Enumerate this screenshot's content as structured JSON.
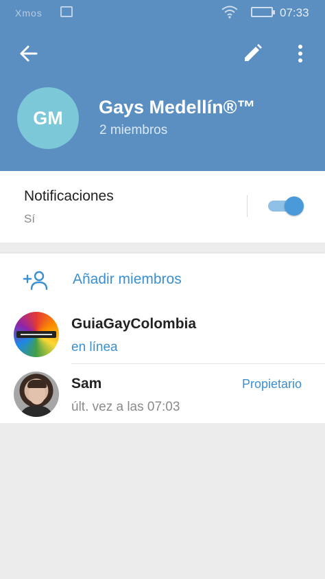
{
  "statusbar": {
    "carrier": "Xmos",
    "time": "07:33"
  },
  "header": {
    "avatar_initials": "GM",
    "title": "Gays Medellín®™",
    "subtitle": "2 miembros",
    "bg_color": "#5b8fc1"
  },
  "notifications": {
    "label": "Notificaciones",
    "value": "Sí",
    "enabled": true
  },
  "members": {
    "add_label": "Añadir miembros",
    "list": [
      {
        "name": "GuiaGayColombia",
        "status": "en línea",
        "role": ""
      },
      {
        "name": "Sam",
        "status": "últ. vez a las 07:03",
        "role": "Propietario"
      }
    ]
  },
  "icons": [
    "back-arrow-icon",
    "pencil-icon",
    "more-vert-icon",
    "add-person-icon",
    "wifi-icon",
    "battery-icon"
  ]
}
